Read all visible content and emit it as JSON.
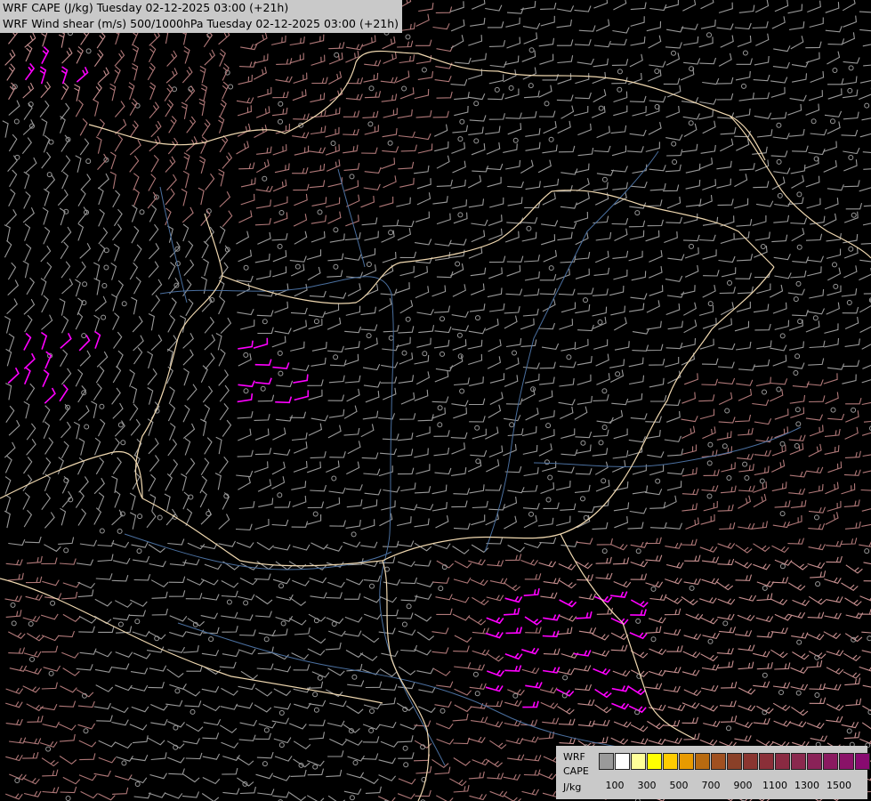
{
  "header": {
    "line1": "WRF CAPE (J/kg) Tuesday 02-12-2025 03:00 (+21h)",
    "line2": "WRF Wind shear (m/s) 500/1000hPa Tuesday 02-12-2025 03:00 (+21h)"
  },
  "legend": {
    "title_lines": [
      "WRF",
      "CAPE",
      "J/kg"
    ],
    "swatch_colors": [
      "#9a9a9a",
      "#ffffff",
      "#ffff99",
      "#ffff00",
      "#ffcc00",
      "#e89a00",
      "#b86a10",
      "#a05020",
      "#8a4028",
      "#8a3530",
      "#8a2f38",
      "#8a2a42",
      "#8a284e",
      "#8a2258",
      "#8a1a60",
      "#8a1268",
      "#880a70"
    ],
    "tick_labels": [
      "100",
      "300",
      "500",
      "700",
      "900",
      "1100",
      "1300",
      "1500"
    ]
  },
  "colors": {
    "background": "#000000",
    "border": "#f0d8b0",
    "river": "#4a6f9f",
    "barb_weak": "#9a9a9a",
    "barb_mid": "#b07878",
    "barb_strong": "#c89090",
    "barb_max": "#ff00ff"
  }
}
